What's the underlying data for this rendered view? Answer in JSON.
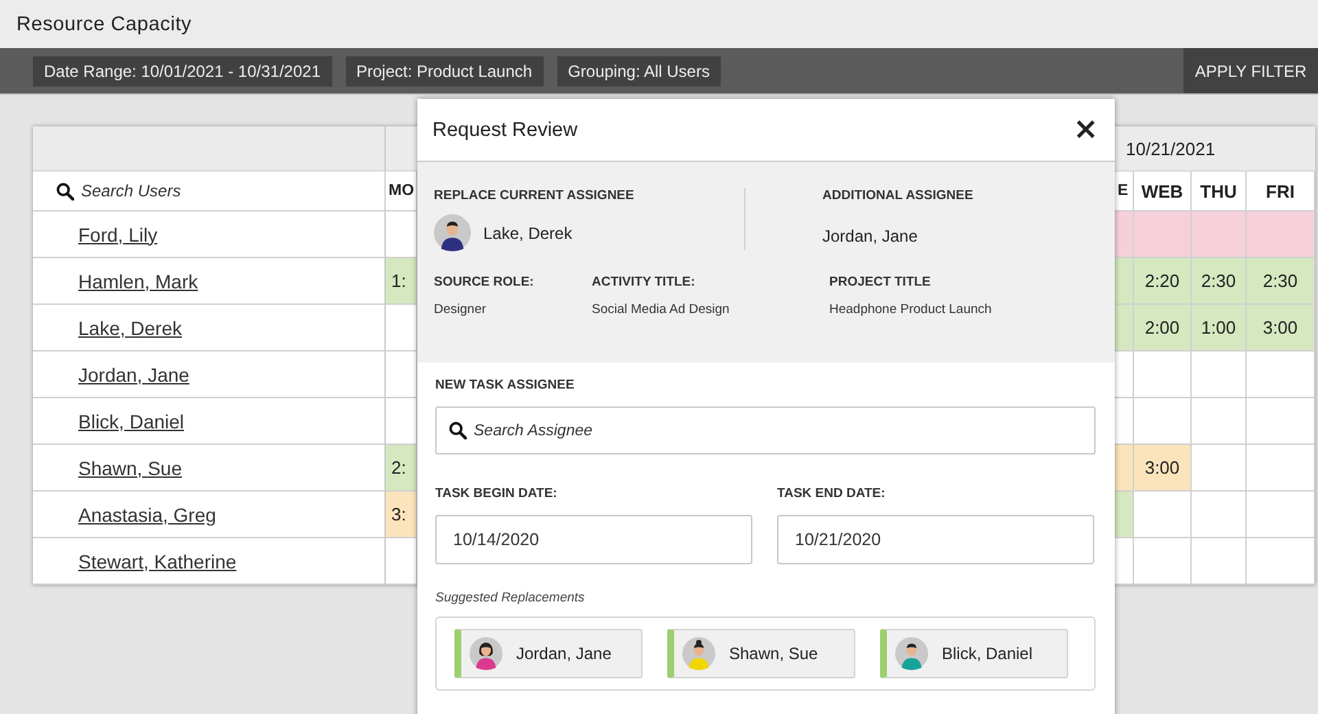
{
  "page": {
    "title": "Resource Capacity"
  },
  "filters": [
    "Date Range: 10/01/2021 - 10/31/2021",
    "Project: Product Launch",
    "Grouping: All Users"
  ],
  "apply_button": "APPLY FILTER",
  "table": {
    "date_heading": "10/21/2021",
    "search_placeholder": "Search Users",
    "columns": [
      "MO",
      "E",
      "WEB",
      "THU",
      "FRI"
    ],
    "rows": [
      {
        "name": "Ford, Lily",
        "cells": [
          {},
          {
            "color": "#f5d0da"
          },
          {
            "color": "#f5d0da"
          },
          {
            "color": "#f5d0da"
          },
          {
            "color": "#f5d0da"
          }
        ]
      },
      {
        "name": "Hamlen, Mark",
        "cells": [
          {
            "text": "1:",
            "color": "#d5e8bf"
          },
          {
            "color": "#d5e8bf"
          },
          {
            "text": "2:20",
            "color": "#d5e8bf"
          },
          {
            "text": "2:30",
            "color": "#d5e8bf"
          },
          {
            "text": "2:30",
            "color": "#d5e8bf"
          }
        ]
      },
      {
        "name": "Lake, Derek",
        "cells": [
          {},
          {
            "color": "#d5e8bf"
          },
          {
            "text": "2:00",
            "color": "#d5e8bf"
          },
          {
            "text": "1:00",
            "color": "#d5e8bf"
          },
          {
            "text": "3:00",
            "color": "#d5e8bf"
          }
        ]
      },
      {
        "name": "Jordan, Jane",
        "cells": [
          {},
          {},
          {},
          {},
          {}
        ]
      },
      {
        "name": "Blick, Daniel",
        "cells": [
          {},
          {},
          {},
          {},
          {}
        ]
      },
      {
        "name": "Shawn, Sue",
        "cells": [
          {
            "text": "2:",
            "color": "#d5e8bf"
          },
          {
            "color": "#fbe4bc"
          },
          {
            "text": "3:00",
            "color": "#fbe4bc"
          },
          {},
          {}
        ]
      },
      {
        "name": "Anastasia, Greg",
        "cells": [
          {
            "text": "3:",
            "color": "#fbe4bc"
          },
          {
            "color": "#d5e8bf"
          },
          {},
          {},
          {}
        ]
      },
      {
        "name": "Stewart, Katherine",
        "cells": [
          {},
          {},
          {},
          {},
          {}
        ]
      }
    ]
  },
  "modal": {
    "title": "Request Review",
    "close": "×",
    "replace_label": "REPLACE CURRENT ASSIGNEE",
    "current_assignee": {
      "name": "Lake, Derek",
      "color": "#2e3180"
    },
    "additional_label": "ADDITIONAL ASSIGNEE",
    "additional_assignee": "Jordan, Jane",
    "details": [
      {
        "label": "SOURCE ROLE:",
        "value": "Designer"
      },
      {
        "label": "ACTIVITY TITLE:",
        "value": "Social Media Ad Design"
      },
      {
        "label": "PROJECT TITLE",
        "value": "Headphone Product Launch"
      }
    ],
    "new_assignee_label": "NEW TASK ASSIGNEE",
    "search_placeholder": "Search Assignee",
    "begin_label": "TASK BEGIN DATE:",
    "begin_date": "10/14/2020",
    "end_label": "TASK END DATE:",
    "end_date": "10/21/2020",
    "suggested_label": "Suggested Replacements",
    "replacements": [
      {
        "name": "Jordan, Jane",
        "color": "#d93a8e",
        "kind": "long"
      },
      {
        "name": "Shawn, Sue",
        "color": "#f2d600",
        "kind": "bun"
      },
      {
        "name": "Blick, Daniel",
        "color": "#17a398",
        "kind": "short"
      }
    ]
  }
}
